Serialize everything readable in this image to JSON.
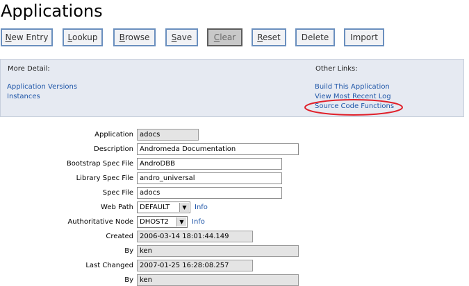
{
  "page": {
    "title": "Applications"
  },
  "toolbar": {
    "new_entry": {
      "first": "N",
      "rest": "ew Entry"
    },
    "lookup": {
      "first": "L",
      "rest": "ookup"
    },
    "browse": {
      "first": "B",
      "rest": "rowse"
    },
    "save": {
      "first": "S",
      "rest": "ave"
    },
    "clear": {
      "first": "C",
      "rest": "lear"
    },
    "reset": {
      "first": "R",
      "rest": "eset"
    },
    "delete": "Delete",
    "import": "Import"
  },
  "links": {
    "more_detail_heading": "More Detail:",
    "other_links_heading": "Other Links:",
    "detail_items": [
      "Application Versions",
      "Instances"
    ],
    "other_items": [
      "Build This Application",
      "View Most Recent Log",
      "Source Code Functions"
    ],
    "annotation_color": "#e0202a"
  },
  "form": {
    "application": {
      "label": "Application",
      "value": "adocs"
    },
    "description": {
      "label": "Description",
      "value": "Andromeda Documentation"
    },
    "bootstrap_spec": {
      "label": "Bootstrap Spec File",
      "value": "AndroDBB"
    },
    "library_spec": {
      "label": "Library Spec File",
      "value": "andro_universal"
    },
    "spec_file": {
      "label": "Spec File",
      "value": "adocs"
    },
    "web_path": {
      "label": "Web Path",
      "value": "DEFAULT",
      "info": "Info"
    },
    "authoritative_node": {
      "label": "Authoritative Node",
      "value": "DHOST2",
      "info": "Info"
    },
    "created": {
      "label": "Created",
      "value": "2006-03-14 18:01:44.149"
    },
    "created_by": {
      "label": "By",
      "value": "ken"
    },
    "last_changed": {
      "label": "Last Changed",
      "value": "2007-01-25 16:28:08.257"
    },
    "changed_by": {
      "label": "By",
      "value": "ken"
    }
  }
}
